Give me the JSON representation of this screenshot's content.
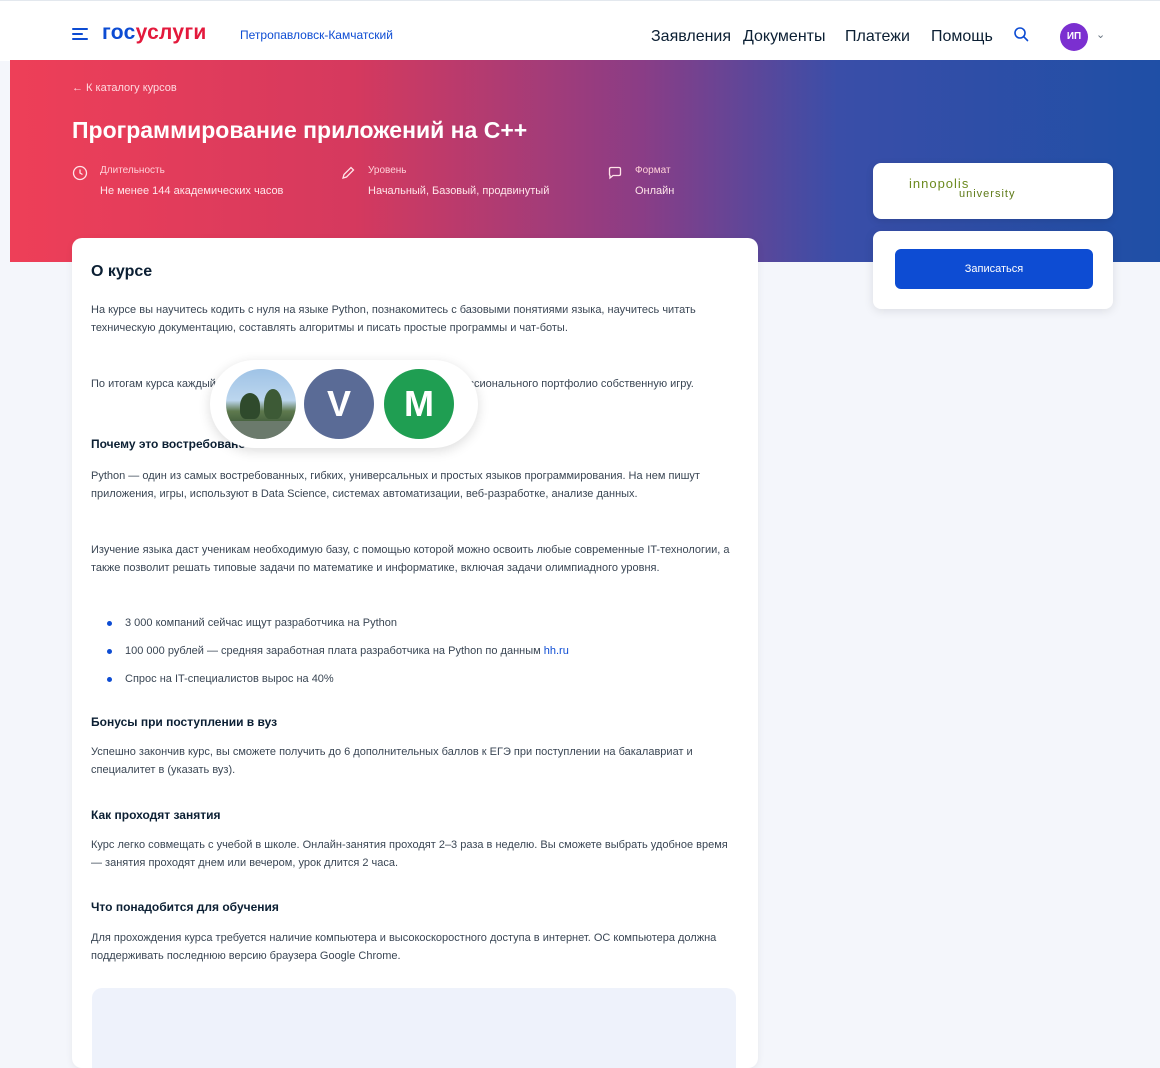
{
  "header": {
    "logo_gos": "гос",
    "logo_uslugi": "услуги",
    "location": "Петропавловск-Камчатский",
    "nav": [
      "Заявления",
      "Документы",
      "Платежи",
      "Помощь"
    ],
    "avatar_initials": "ИП"
  },
  "hero": {
    "breadcrumb": "← К каталогу курсов",
    "title": "Программирование приложений на C++",
    "meta": [
      {
        "label": "Длительность",
        "value": "Не менее 144 академических часов"
      },
      {
        "label": "Уровень",
        "value": "Начальный, Базовый, продвинутый"
      },
      {
        "label": "Формат",
        "value": "Онлайн"
      }
    ]
  },
  "sidebar": {
    "partner_logo_line1": "innopolis",
    "partner_logo_line2": "university",
    "enroll_label": "Записаться"
  },
  "about": {
    "title": "О курсе",
    "p1": "На курсе вы научитесь кодить с нуля на языке Python, познакомитесь с базовыми понятиями языка, научитесь читать техническую документацию, составлять алгоритмы и писать простые программы и чат-боты.",
    "p2": "По итогам курса каждый участник добавит в копилку собственного профессионального портфолио собственную игру.",
    "h_why": "Почему это востребовано",
    "p3": "Python — один из самых востребованных, гибких, универсальных и простых языков программирования. На нем пишут приложения, игры, используют в Data Science, системах автоматизации, веб-разработке, анализе данных.",
    "p4": "Изучение языка даст ученикам необходимую базу, с помощью которой можно освоить любые современные IT-технологии, а также позволит решать типовые задачи по математике и информатике, включая задачи олимпиадного уровня.",
    "bullets": [
      {
        "text": "3 000 компаний сейчас ищут разработчика на Python",
        "link": ""
      },
      {
        "text": "100 000 рублей — средняя заработная плата разработчика на Python по данным ",
        "link": "hh.ru"
      },
      {
        "text": "Спрос на IT-специалистов вырос на 40%",
        "link": ""
      }
    ],
    "h_bonus": "Бонусы при поступлении в вуз",
    "p5": "Успешно закончив курс, вы сможете получить до 6 дополнительных баллов к ЕГЭ при поступлении на бакалавриат и специалитет в (указать вуз).",
    "h_how": "Как проходят занятия",
    "p6": "Курс легко совмещать с учебой в школе. Онлайн-занятия проходят 2–3 раза в неделю. Вы сможете выбрать удобное время — занятия проходят днем или вечером, урок длится 2 часа.",
    "h_need": "Что понадобится для обучения",
    "p7": "Для прохождения курса требуется наличие компьютера и высокоскоростного доступа в интернет. ОС компьютера должна поддерживать последнюю версию браузера Google Chrome."
  },
  "overlay": {
    "avatars": [
      {
        "type": "photo",
        "label": ""
      },
      {
        "type": "letter",
        "label": "V"
      },
      {
        "type": "letter",
        "label": "M"
      }
    ]
  },
  "colors": {
    "accent": "#0d4cd3",
    "brand_red": "#e3193c",
    "hero_left": "#ee3f58",
    "hero_right": "#1f4fa6"
  }
}
